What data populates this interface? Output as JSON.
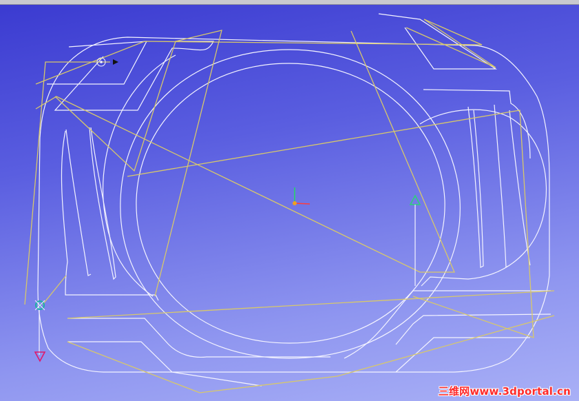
{
  "viewport": {
    "name": "3D toolpath viewport"
  },
  "colors": {
    "geometry_outline": "#f4f4ff",
    "rapid_toolpath": "#d8c86a",
    "axis_x": "#ff3b3b",
    "axis_y": "#27d46a",
    "axis_origin": "#f0a020",
    "start_marker": "#2fd07a",
    "end_marker": "#e0186a",
    "tool_marker": "#1fb0a8",
    "watermark": "#ff2a2a"
  },
  "markers": {
    "axis_triad": "xyz-axis-triad-icon",
    "start": "start-triangle-icon",
    "end": "end-triangle-icon",
    "tool": "tool-position-icon",
    "entry": "entry-point-icon"
  },
  "watermark": {
    "text": "三维网www.3dportal.cn"
  }
}
